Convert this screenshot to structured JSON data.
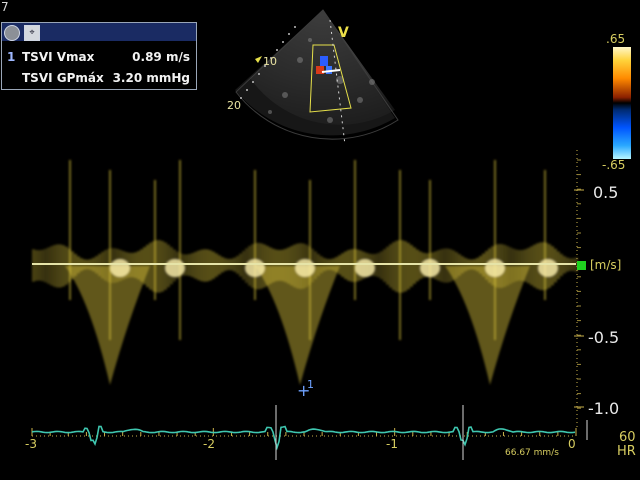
{
  "page_number": "7",
  "measurement_panel": {
    "rows": [
      {
        "index": "1",
        "label": "TSVI Vmax",
        "value": "0.89 m/s"
      },
      {
        "index": "",
        "label": "TSVI GPmáx",
        "value": "3.20 mmHg"
      }
    ]
  },
  "sector": {
    "orientation_marker": "V",
    "depth_labels": [
      "10",
      "20"
    ]
  },
  "color_scale": {
    "max": ".65",
    "min": "-.65"
  },
  "velocity_axis": {
    "ticks": [
      "0.5",
      "-0.5",
      "-1.0"
    ],
    "baseline_unit": "[m/s]"
  },
  "time_axis": {
    "ticks": [
      "-3",
      "-2",
      "-1",
      "0"
    ]
  },
  "sweep_speed": "66.67 mm/s",
  "heart_rate": {
    "value": "60",
    "unit": "HR"
  },
  "cursor": {
    "index": "1"
  },
  "colors": {
    "accent_yellow": "#d7cd60",
    "ecg_trace": "#3fc7b0",
    "doppler": "#d8c23a",
    "titlebar": "#1a2b63",
    "cursor": "#6fa2ff"
  }
}
